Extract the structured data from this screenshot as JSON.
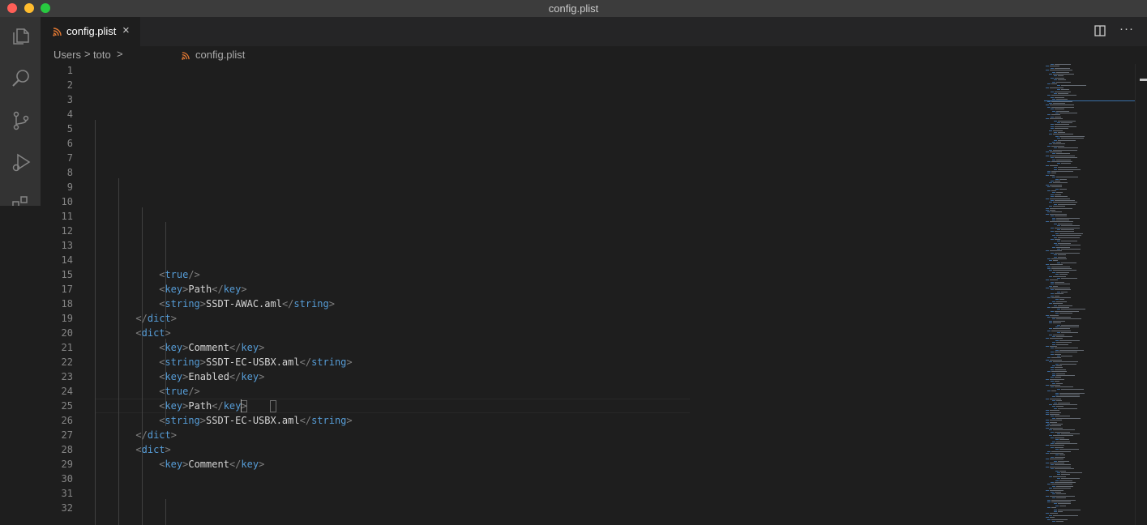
{
  "window": {
    "title": "config.plist"
  },
  "activity_bar": {
    "icons": [
      "files-icon",
      "search-icon",
      "source-control-icon",
      "run-debug-icon",
      "extensions-icon"
    ]
  },
  "tab": {
    "label": "config.plist",
    "close": "×"
  },
  "editor_actions": {
    "more": "···"
  },
  "breadcrumb": {
    "items": [
      "Users",
      "toto",
      "config.plist"
    ],
    "separator": ">"
  },
  "colors": {
    "tag": "#569cd6",
    "bracket": "#808080",
    "text": "#d4d4d4",
    "line_number": "#858585",
    "xml_icon": "#e37933"
  },
  "line_numbers": [
    "1",
    "2",
    "3",
    "4",
    "5",
    "6",
    "7",
    "8",
    "9",
    "10",
    "11",
    "12",
    "13",
    "14",
    "15",
    "17",
    "18",
    "19",
    "20",
    "21",
    "22",
    "23",
    "24",
    "25",
    "26",
    "27",
    "28",
    "29",
    "30",
    "31",
    "32"
  ],
  "code_lines": [
    {
      "indent": 4,
      "tag": "true",
      "selfclose": true
    },
    {
      "indent": 4,
      "tag": "key",
      "text": "Path"
    },
    {
      "indent": 4,
      "tag": "string",
      "text": "SSDT-AWAC.aml"
    },
    {
      "indent": 3,
      "close": "dict"
    },
    {
      "indent": 3,
      "open": "dict"
    },
    {
      "indent": 4,
      "tag": "key",
      "text": "Comment"
    },
    {
      "indent": 4,
      "tag": "string",
      "text": "SSDT-EC-USBX.aml"
    },
    {
      "indent": 4,
      "tag": "key",
      "text": "Enabled"
    },
    {
      "indent": 4,
      "tag": "true",
      "selfclose": true
    },
    {
      "indent": 4,
      "tag": "key",
      "text": "Path"
    },
    {
      "indent": 4,
      "tag": "string",
      "text": "SSDT-EC-USBX.aml"
    },
    {
      "indent": 3,
      "close": "dict"
    },
    {
      "indent": 3,
      "open": "dict"
    },
    {
      "indent": 4,
      "tag": "key",
      "text": "Comment"
    }
  ]
}
